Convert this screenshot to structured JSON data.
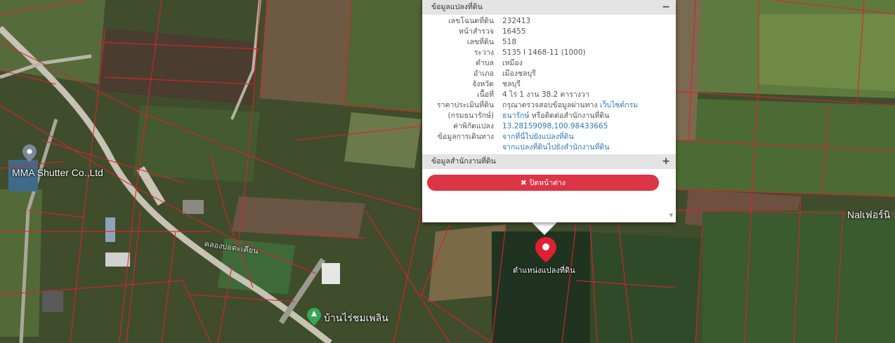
{
  "popup": {
    "section1_title": "ข้อมูลแปลงที่ดิน",
    "section1_toggle": "−",
    "rows": [
      {
        "label": "เลขโฉนดที่ดิน",
        "value": "232413"
      },
      {
        "label": "หน้าสำรวจ",
        "value": "16455"
      },
      {
        "label": "เลขที่ดิน",
        "value": "518"
      },
      {
        "label": "ระวาง",
        "value": "5135 I 1468-11 (1000)"
      },
      {
        "label": "ตำบล",
        "value": "เหมือง"
      },
      {
        "label": "อำเภอ",
        "value": "เมืองชลบุรี"
      },
      {
        "label": "จังหวัด",
        "value": "ชลบุรี"
      },
      {
        "label": "เนื้อที่",
        "value": "4 ไร่ 1 งาน 38.2 ตารางวา"
      }
    ],
    "price_label_1": "ราคาประเมินที่ดิน",
    "price_label_2": "(กรมธนารักษ์)",
    "price_text_1": "กรุณาตรวจสอบข้อมูลผ่านทาง",
    "price_link": "เว็บไซต์กรมธนารักษ์",
    "price_link_1": "เว็บไซต์กรม",
    "price_link_2": "ธนารักษ์",
    "price_text_2": "หรือติดต่อสำนักงานที่ดิน",
    "coord_label": "ค่าพิกัดแปลง",
    "coord_value": "13.28159098,100.98433665",
    "travel_label": "ข้อมูลการเดินทาง",
    "travel_link_1": "จากที่นี่ไปยังแปลงที่ดิน",
    "travel_link_2": "จากแปลงที่ดินไปยังสำนักงานที่ดิน",
    "section2_title": "ข้อมูลสำนักงานที่ดิน",
    "section2_toggle": "+",
    "close_label": "ปิดหน้าต่าง",
    "close_icon": "x-icon",
    "scroll_icon": "scroll-down-icon"
  },
  "map": {
    "marker_label": "ตำแหน่งแปลงที่ดิน",
    "marker_icon": "map-pin-icon",
    "marker_color": "#e0202f",
    "labels": {
      "mma": "MMA Shutter Co.,Ltd",
      "canal": "คลองบ่อตะเคียน",
      "village": "บ้านไร่ชมเพลิน",
      "right_edge": "Nalเฟอร์นิ"
    },
    "poi_pin_color": "#7a8a99",
    "park_pin_color": "#34a853",
    "boundary_color": "#e0202f"
  }
}
